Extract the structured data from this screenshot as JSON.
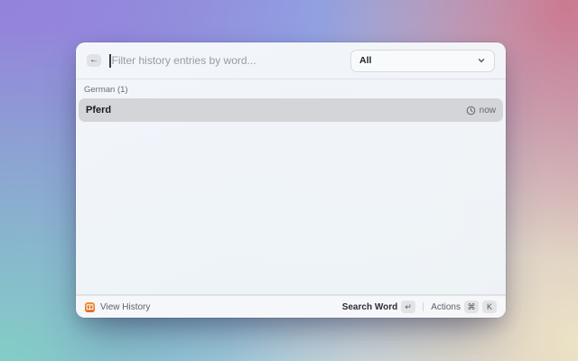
{
  "header": {
    "back_icon_glyph": "←",
    "search_placeholder": "Filter history entries by word...",
    "dropdown_value": "All"
  },
  "list": {
    "section_title": "German (1)",
    "items": [
      {
        "title": "Pferd",
        "time": "now"
      }
    ]
  },
  "footer": {
    "extension_name": "View History",
    "primary_action": "Search Word",
    "primary_key_glyph": "↵",
    "secondary_action": "Actions",
    "secondary_keys": [
      "⌘",
      "K"
    ]
  },
  "colors": {
    "extension_icon_accent": "#e8701f",
    "selected_row": "#d3d5d9",
    "window_background": "#f2f6f9"
  }
}
